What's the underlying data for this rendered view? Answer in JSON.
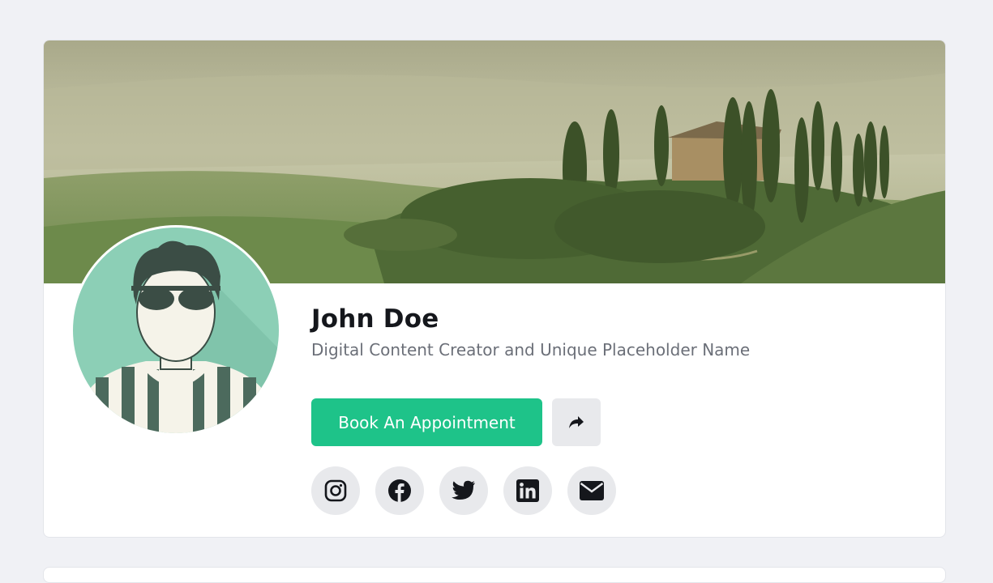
{
  "profile": {
    "name": "John Doe",
    "subtitle": "Digital Content Creator and Unique Placeholder Name"
  },
  "actions": {
    "book_label": "Book An Appointment",
    "share_icon": "share-icon"
  },
  "socials": [
    {
      "icon": "instagram-icon"
    },
    {
      "icon": "facebook-icon"
    },
    {
      "icon": "twitter-icon"
    },
    {
      "icon": "linkedin-icon"
    },
    {
      "icon": "email-icon"
    }
  ],
  "colors": {
    "accent": "#1ec389",
    "page_background": "#f0f1f5",
    "icon_button_background": "#e8e9ec",
    "avatar_background": "#8ccfb6"
  }
}
